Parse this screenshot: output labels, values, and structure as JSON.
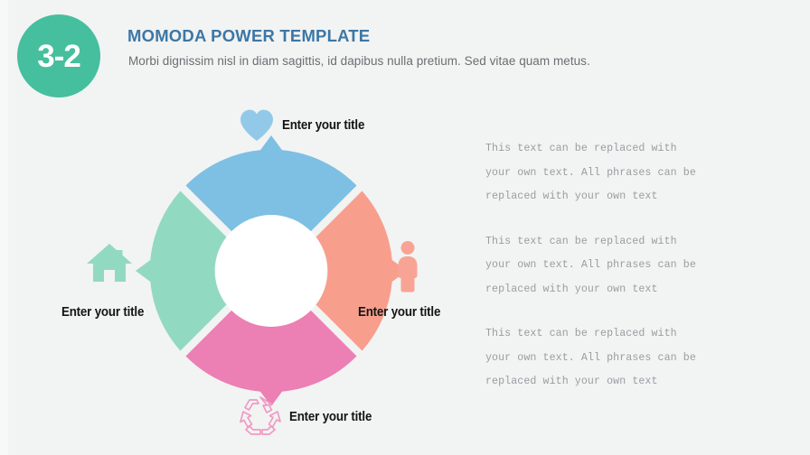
{
  "slide": {
    "background_color": "#f2f3f3",
    "badge": {
      "label": "3-2",
      "color": "#45bf9e",
      "text_color": "#ffffff"
    },
    "header": {
      "title": "MOMODA POWER TEMPLATE",
      "title_color": "#3c77a6",
      "subtitle": "Morbi dignissim nisl in diam sagittis, id dapibus nulla pretium. Sed vitae quam metus.",
      "subtitle_color": "#6b6f72"
    }
  },
  "chart_data": {
    "type": "pie",
    "title": "",
    "subtype": "donut-4-segment-arrow",
    "legend_position": "around-chart",
    "center_hole": true,
    "categories": [
      "Enter your title",
      "Enter your title",
      "Enter your title",
      "Enter your title"
    ],
    "values": [
      25,
      25,
      25,
      25
    ],
    "segments": [
      {
        "position": "top",
        "label": "Enter your title",
        "color": "#7dc0e3",
        "icon": "heart-icon",
        "icon_color": "#93c9e8",
        "start_angle": -50,
        "end_angle": 50
      },
      {
        "position": "right",
        "label": "Enter your title",
        "color": "#f79f8c",
        "icon": "person-icon",
        "icon_color": "#f7a494",
        "start_angle": 40,
        "end_angle": 140
      },
      {
        "position": "bottom",
        "label": "Enter your title",
        "color": "#ec7fb3",
        "icon": "recycle-icon",
        "icon_color": "#ef9ac3",
        "start_angle": 130,
        "end_angle": 230
      },
      {
        "position": "left",
        "label": "Enter your title",
        "color": "#92d9c2",
        "icon": "house-icon",
        "icon_color": "#92d9c2",
        "start_angle": 220,
        "end_angle": 320
      }
    ]
  },
  "body": {
    "paragraphs": [
      "This text can be replaced with your own text. All phrases can be replaced with your own text",
      "This text can be replaced with your own text. All phrases can be replaced with your own text",
      "This text can be replaced with your own text. All phrases can be replaced with your own text"
    ],
    "text_color": "#9a9da0"
  }
}
